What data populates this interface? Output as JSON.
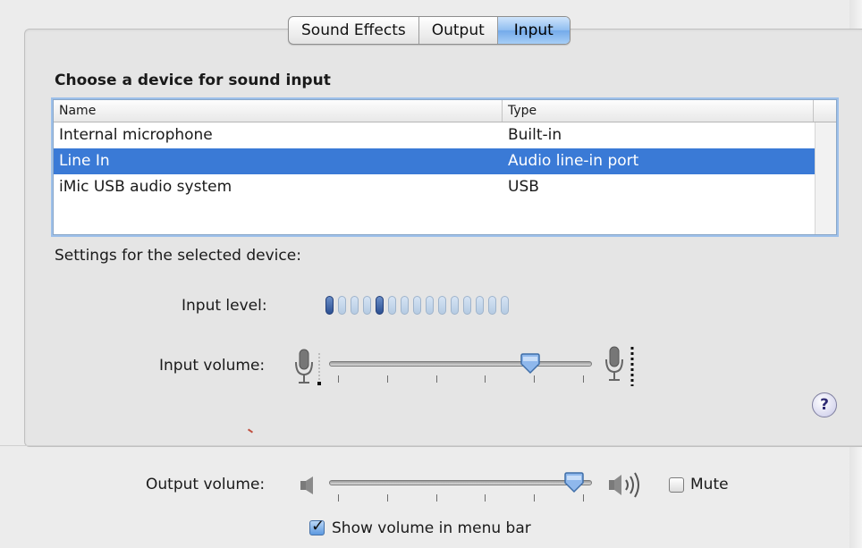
{
  "tabs": [
    {
      "label": "Sound Effects",
      "selected": false
    },
    {
      "label": "Output",
      "selected": false
    },
    {
      "label": "Input",
      "selected": true
    }
  ],
  "input_section": {
    "title": "Choose a device for sound input",
    "table": {
      "columns": [
        "Name",
        "Type"
      ],
      "rows": [
        {
          "name": "Internal microphone",
          "type": "Built-in",
          "selected": false
        },
        {
          "name": "Line In",
          "type": "Audio line-in port",
          "selected": true
        },
        {
          "name": "iMic USB audio system",
          "type": "USB",
          "selected": false
        }
      ]
    },
    "settings_label": "Settings for the selected device:",
    "input_level": {
      "label": "Input level:",
      "total_segments": 15,
      "lit_segments": [
        1,
        5
      ]
    },
    "input_volume": {
      "label": "Input volume:",
      "value_fraction": 0.79
    }
  },
  "output": {
    "volume_label": "Output volume:",
    "volume_fraction": 0.97,
    "mute_label": "Mute",
    "mute_checked": false,
    "show_volume_label": "Show volume in menu bar",
    "show_volume_checked": true
  },
  "help": {
    "glyph": "?"
  },
  "colors": {
    "selection": "#3a7ad6",
    "tab_selected": "#8fbdf0",
    "meter_on": "#2b4f92",
    "meter_off": "#c3d4e8"
  }
}
